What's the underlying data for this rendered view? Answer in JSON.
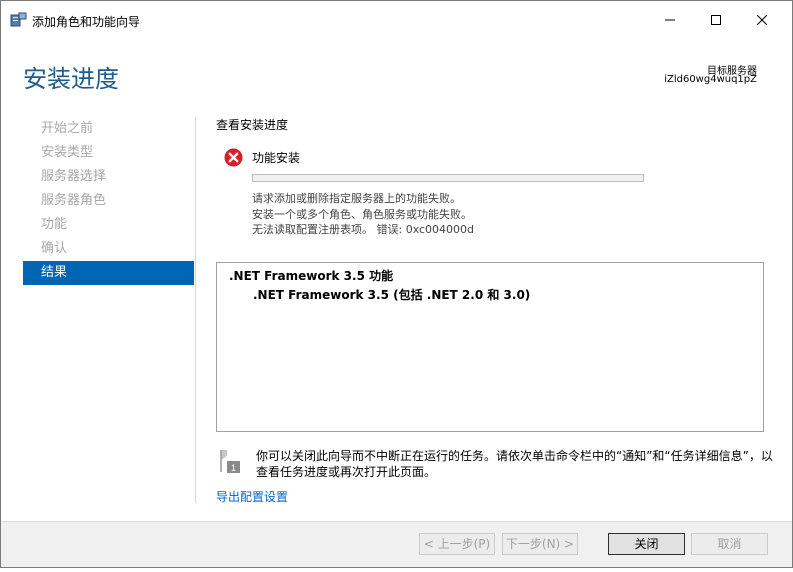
{
  "window": {
    "title": "添加角色和功能向导",
    "icons": {
      "app": "server-manager-icon",
      "minimize": "minimize-icon",
      "maximize": "maximize-icon",
      "close": "close-icon"
    }
  },
  "header": {
    "page_title": "安装进度",
    "target_label": "目标服务器",
    "target_value": "iZld60wg4wuq1pZ"
  },
  "nav": {
    "items": [
      {
        "label": "开始之前",
        "active": false
      },
      {
        "label": "安装类型",
        "active": false
      },
      {
        "label": "服务器选择",
        "active": false
      },
      {
        "label": "服务器角色",
        "active": false
      },
      {
        "label": "功能",
        "active": false
      },
      {
        "label": "确认",
        "active": false
      },
      {
        "label": "结果",
        "active": true
      }
    ]
  },
  "main": {
    "section_heading": "查看安装进度",
    "status_icon": "error-icon",
    "feature_install_label": "功能安装",
    "progress": 0,
    "messages": [
      "请求添加或删除指定服务器上的功能失败。",
      "安装一个或多个角色、角色服务或功能失败。",
      "无法读取配置注册表项。 错误: 0xc004000d"
    ],
    "results": [
      ".NET Framework 3.5 功能",
      ".NET Framework 3.5 (包括 .NET 2.0 和 3.0)"
    ],
    "note_icon": "notification-flag-icon",
    "note_line1": "你可以关闭此向导而不中断正在运行的任务。请依次单击命令栏中的“通知”和“任务详细信息”，以",
    "note_line2": "查看任务进度或再次打开此页面。",
    "export_link": "导出配置设置"
  },
  "footer": {
    "prev_label": "< 上一步(P)",
    "next_label": "下一步(N) >",
    "close_label": "关闭",
    "cancel_label": "取消"
  },
  "colors": {
    "title_blue": "#1e5d8d",
    "nav_active_bg": "#0066b4",
    "link": "#0066cc",
    "error_red": "#d61f26"
  }
}
